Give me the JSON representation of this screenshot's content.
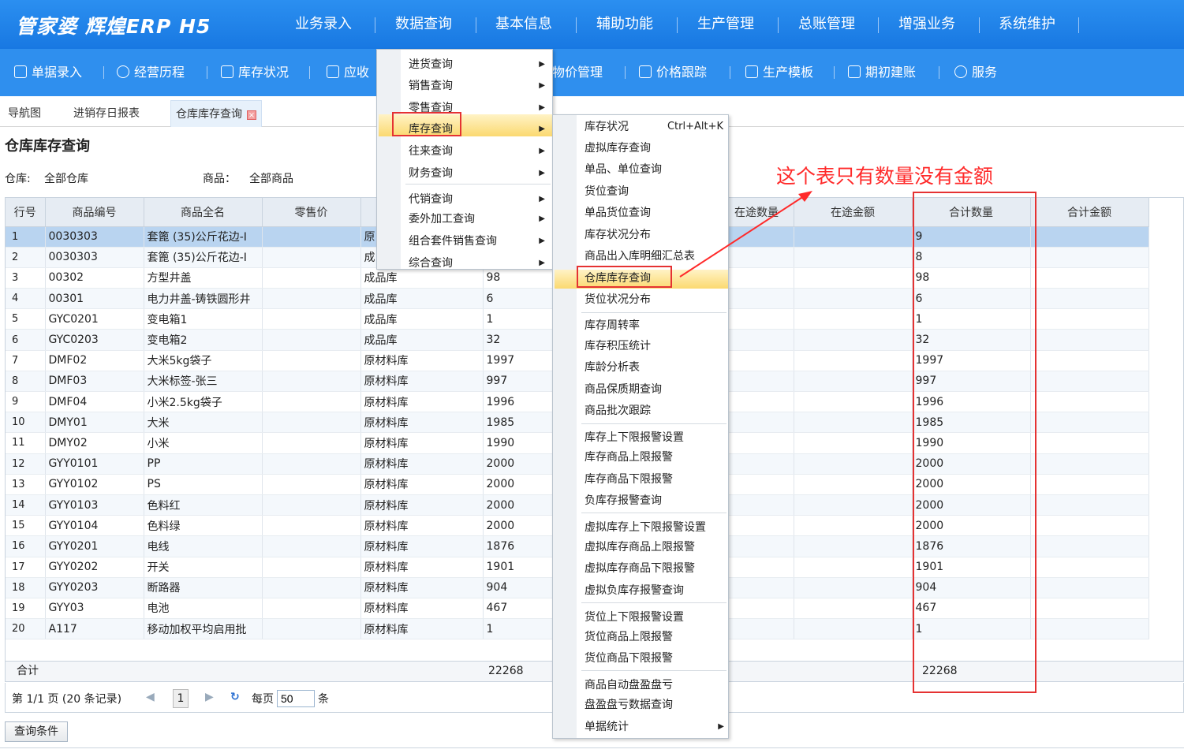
{
  "app": {
    "logo": "管家婆 辉煌ERP H5"
  },
  "topmenu": [
    "业务录入",
    "数据查询",
    "基本信息",
    "辅助功能",
    "生产管理",
    "总账管理",
    "增强业务",
    "系统维护"
  ],
  "toolbar": [
    "单据录入",
    "经营历程",
    "库存状况",
    "应收",
    "物价管理",
    "价格跟踪",
    "生产模板",
    "期初建账",
    "服务"
  ],
  "tabs": [
    "导航图",
    "进销存日报表",
    "仓库库存查询"
  ],
  "page": {
    "title": "仓库库存查询",
    "warehouse_label": "仓库:",
    "warehouse_value": "全部仓库",
    "product_label": "商品：",
    "product_value": "全部商品"
  },
  "grid": {
    "columns": [
      "行号",
      "商品编号",
      "商品全名",
      "零售价",
      "",
      "",
      "",
      "",
      "在途数量",
      "在途金额",
      "合计数量",
      "合计金额"
    ],
    "rows": [
      [
        "1",
        "0030303",
        "套篦 (35)公斤花边-I",
        "原",
        "",
        "9"
      ],
      [
        "2",
        "0030303",
        "套篦 (35)公斤花边-I",
        "成",
        "",
        "8"
      ],
      [
        "3",
        "00302",
        "方型井盖",
        "成品库",
        "98",
        "98"
      ],
      [
        "4",
        "00301",
        "电力井盖-铸铁圆形井",
        "成品库",
        "6",
        "6"
      ],
      [
        "5",
        "GYC0201",
        "变电箱1",
        "成品库",
        "1",
        "1"
      ],
      [
        "6",
        "GYC0203",
        "变电箱2",
        "成品库",
        "32",
        "32"
      ],
      [
        "7",
        "DMF02",
        "大米5kg袋子",
        "原材料库",
        "1997",
        "1997"
      ],
      [
        "8",
        "DMF03",
        "大米标签-张三",
        "原材料库",
        "997",
        "997"
      ],
      [
        "9",
        "DMF04",
        "小米2.5kg袋子",
        "原材料库",
        "1996",
        "1996"
      ],
      [
        "10",
        "DMY01",
        "大米",
        "原材料库",
        "1985",
        "1985"
      ],
      [
        "11",
        "DMY02",
        "小米",
        "原材料库",
        "1990",
        "1990"
      ],
      [
        "12",
        "GYY0101",
        "PP",
        "原材料库",
        "2000",
        "2000"
      ],
      [
        "13",
        "GYY0102",
        "PS",
        "原材料库",
        "2000",
        "2000"
      ],
      [
        "14",
        "GYY0103",
        "色料红",
        "原材料库",
        "2000",
        "2000"
      ],
      [
        "15",
        "GYY0104",
        "色料绿",
        "原材料库",
        "2000",
        "2000"
      ],
      [
        "16",
        "GYY0201",
        "电线",
        "原材料库",
        "1876",
        "1876"
      ],
      [
        "17",
        "GYY0202",
        "开关",
        "原材料库",
        "1901",
        "1901"
      ],
      [
        "18",
        "GYY0203",
        "断路器",
        "原材料库",
        "904",
        "904"
      ],
      [
        "19",
        "GYY03",
        "电池",
        "原材料库",
        "467",
        "467"
      ],
      [
        "20",
        "A117",
        "移动加权平均启用批",
        "原材料库",
        "1",
        "1"
      ]
    ],
    "sum_label": "合计",
    "sum_qty": "22268",
    "sum_total": "22268"
  },
  "pager": {
    "info": "第 1/1 页 (20 条记录)",
    "page": "1",
    "per_page_label": "每页",
    "per_page": "50",
    "unit": "条"
  },
  "query_button": "查询条件",
  "menu1": [
    "进货查询",
    "销售查询",
    "零售查询",
    "库存查询",
    "往来查询",
    "财务查询",
    "代销查询",
    "委外加工查询",
    "组合套件销售查询",
    "综合查询"
  ],
  "menu2": [
    "库存状况",
    "虚拟库存查询",
    "单品、单位查询",
    "货位查询",
    "单品货位查询",
    "库存状况分布",
    "商品出入库明细汇总表",
    "仓库库存查询",
    "货位状况分布",
    "库存周转率",
    "库存积压统计",
    "库龄分析表",
    "商品保质期查询",
    "商品批次跟踪",
    "库存上下限报警设置",
    "库存商品上限报警",
    "库存商品下限报警",
    "负库存报警查询",
    "虚拟库存上下限报警设置",
    "虚拟库存商品上限报警",
    "虚拟库存商品下限报警",
    "虚拟负库存报警查询",
    "货位上下限报警设置",
    "货位商品上限报警",
    "货位商品下限报警",
    "商品自动盘盈盘亏",
    "盘盈盘亏数据查询",
    "单据统计"
  ],
  "menu2_shortcut": "Ctrl+Alt+K",
  "annotation": "这个表只有数量没有金额",
  "colors": {
    "topbar": "#1878e2",
    "annotation": "#ff2a2a",
    "highlight": "#fbd970"
  }
}
